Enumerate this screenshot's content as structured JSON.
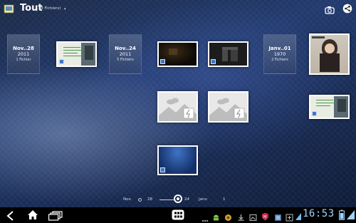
{
  "header": {
    "title": "Tout",
    "count": "(8 Fichiers)",
    "dropdown_caret": "▾"
  },
  "date_groups": [
    {
      "date": "Nov..28",
      "year": "2011",
      "count": "1 Fichier"
    },
    {
      "date": "Nov..24",
      "year": "2011",
      "count": "5 Fichiers"
    },
    {
      "date": "Janv..01",
      "year": "1970",
      "count": "2 Fichiers"
    }
  ],
  "slider": {
    "label1": "Nov.",
    "value1": "28",
    "value2": "24",
    "label3": "Janv.",
    "value3": "1"
  },
  "clock": "16:53",
  "colors": {
    "clock": "#9fd2ff",
    "accent_blue": "#3e77c9"
  }
}
